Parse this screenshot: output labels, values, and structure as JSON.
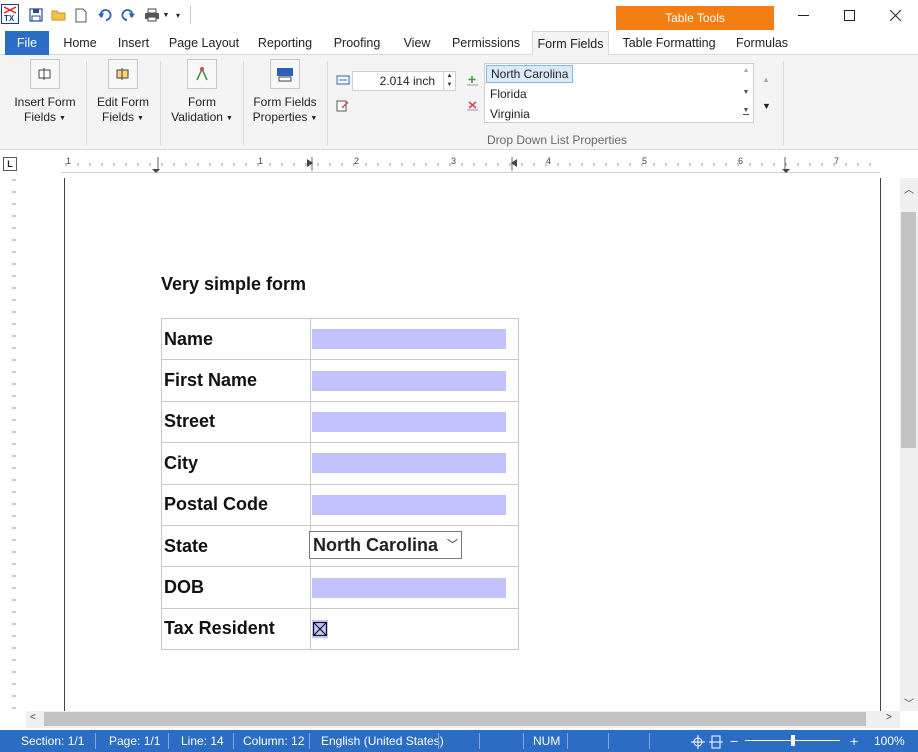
{
  "tools_tab": "Table Tools",
  "tabs": [
    {
      "label": "File"
    },
    {
      "label": "Home"
    },
    {
      "label": "Insert"
    },
    {
      "label": "Page Layout"
    },
    {
      "label": "Reporting"
    },
    {
      "label": "Proofing"
    },
    {
      "label": "View"
    },
    {
      "label": "Permissions"
    },
    {
      "label": "Form Fields"
    },
    {
      "label": "Table Formatting"
    },
    {
      "label": "Formulas"
    }
  ],
  "ribbon": {
    "insert_form_fields": "Insert Form\nFields",
    "edit_form_fields": "Edit Form\nFields",
    "form_validation": "Form\nValidation",
    "form_fields_properties": "Form Fields\nProperties",
    "width_value": "2.014  inch",
    "dropdown_items": [
      "North Carolina",
      "Florida",
      "Virginia"
    ],
    "group_label": "Drop Down List Properties"
  },
  "document": {
    "title": "Very simple form",
    "rows": [
      {
        "label": "Name",
        "kind": "text"
      },
      {
        "label": "First Name",
        "kind": "text"
      },
      {
        "label": "Street",
        "kind": "text"
      },
      {
        "label": "City",
        "kind": "text"
      },
      {
        "label": "Postal Code",
        "kind": "text"
      },
      {
        "label": "State",
        "kind": "dropdown",
        "value": "North Carolina"
      },
      {
        "label": "DOB",
        "kind": "text"
      },
      {
        "label": "Tax Resident",
        "kind": "checkbox",
        "checked": true
      }
    ]
  },
  "ruler_numbers": [
    "1",
    "1",
    "2",
    "3",
    "4",
    "5",
    "6",
    "7"
  ],
  "status": {
    "section": "Section: 1/1",
    "page": "Page: 1/1",
    "line": "Line: 14",
    "column": "Column: 12",
    "language": "English (United States)",
    "num": "NUM",
    "zoom": "100%",
    "zoom_level": 1.0
  },
  "colors": {
    "accent": "#2b6cc4",
    "tools_tab": "#f47d14",
    "field_fill": "#c2c2ff"
  }
}
